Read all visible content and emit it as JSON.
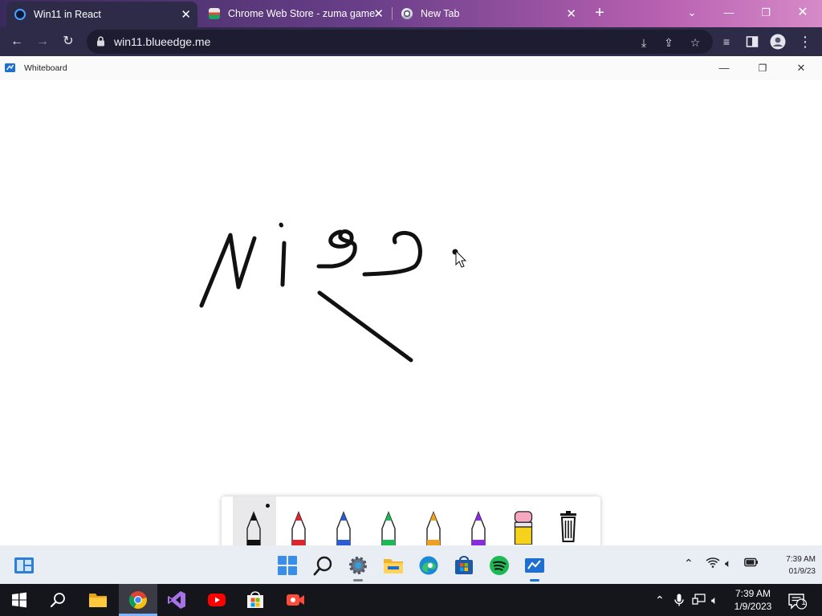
{
  "browser": {
    "tabs": [
      {
        "title": "Win11 in React",
        "active": true
      },
      {
        "title": "Chrome Web Store - zuma game",
        "active": false
      },
      {
        "title": "New Tab",
        "active": false
      }
    ],
    "url": "win11.blueedge.me"
  },
  "whiteboard": {
    "title": "Whiteboard",
    "tools": [
      "pen-black",
      "pen-red",
      "pen-blue",
      "pen-green",
      "pen-orange",
      "pen-purple",
      "highlighter-yellow",
      "trash"
    ],
    "colors": {
      "black": "#111111",
      "red": "#e0242d",
      "blue": "#2b5cd6",
      "green": "#1db954",
      "orange": "#f0a020",
      "purple": "#8a2be2",
      "yellow": "#f7d21c"
    }
  },
  "w11_taskbar": {
    "apps": [
      "widgets",
      "start",
      "search",
      "settings",
      "file-explorer",
      "edge",
      "store",
      "spotify",
      "whiteboard"
    ],
    "time": "7:39 AM",
    "date": "01/9/23"
  },
  "w10_taskbar": {
    "apps": [
      "start",
      "search",
      "file-explorer",
      "chrome",
      "visual-studio",
      "youtube",
      "store",
      "recorder"
    ],
    "time": "7:39 AM",
    "date": "1/9/2023",
    "notification_count": "1"
  }
}
